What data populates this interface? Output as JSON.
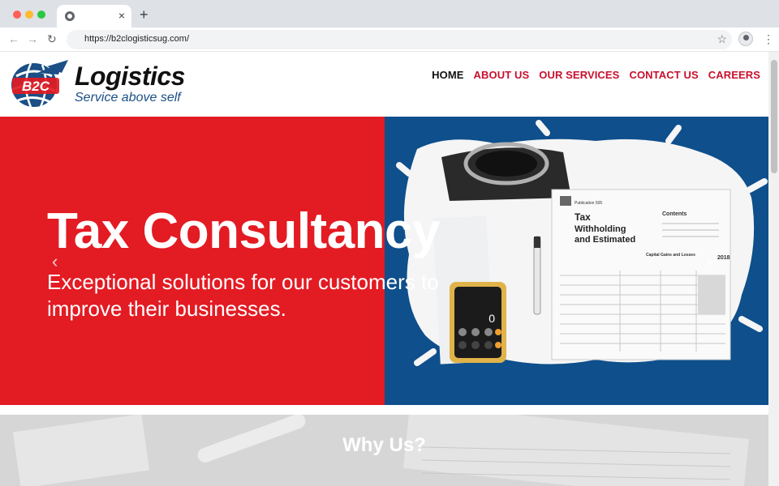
{
  "browser": {
    "tab_close": "×",
    "new_tab": "+",
    "url": "https://b2clogisticsug.com/",
    "icons": [
      "chrome-icon",
      "back-icon",
      "forward-icon",
      "reload-icon",
      "star-icon",
      "profile-icon",
      "menu-icon"
    ]
  },
  "site": {
    "logo": {
      "mark_text": "B2C",
      "title": "Logistics",
      "tagline": "Service above self"
    },
    "nav": [
      {
        "label": "HOME",
        "active": true
      },
      {
        "label": "ABOUT US",
        "active": false
      },
      {
        "label": "OUR SERVICES",
        "active": false
      },
      {
        "label": "CONTACT US",
        "active": false
      },
      {
        "label": "CAREERS",
        "active": false
      }
    ],
    "hero": {
      "title": "Tax Consultancy",
      "subtitle": "Exceptional solutions for our customers to improve their businesses.",
      "colors": {
        "left": "#e31b23",
        "right": "#0e4f8c"
      },
      "image": {
        "document_title": "Tax Withholding and Estimated",
        "publication": "Publication 505",
        "contents": "Contents",
        "year": "2018",
        "table_title": "Capital Gains and Losses",
        "calculator_display": "0"
      }
    },
    "why": {
      "title": "Why Us?"
    }
  }
}
